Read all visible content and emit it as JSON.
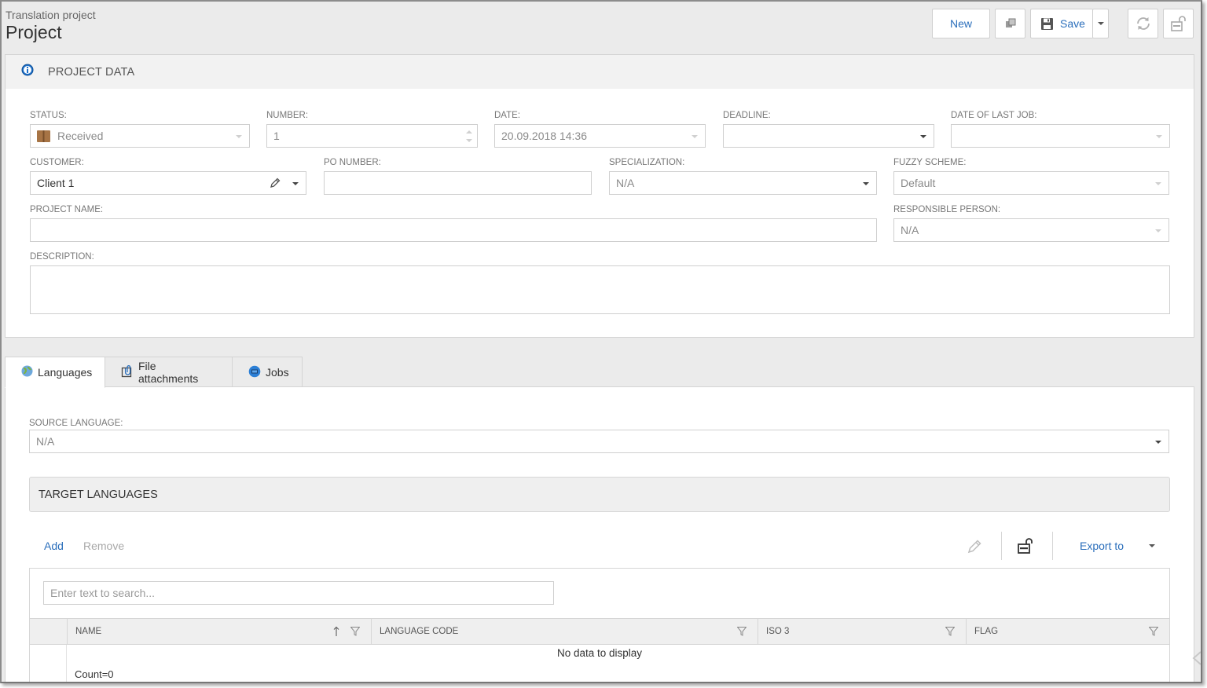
{
  "header": {
    "subtitle": "Translation project",
    "title": "Project",
    "new_label": "New",
    "save_label": "Save"
  },
  "project_data": {
    "title": "PROJECT DATA",
    "status_label": "STATUS:",
    "status_value": "Received",
    "number_label": "NUMBER:",
    "number_value": "1",
    "date_label": "DATE:",
    "date_value": "20.09.2018 14:36",
    "deadline_label": "DEADLINE:",
    "deadline_value": "",
    "date_last_job_label": "DATE OF LAST JOB:",
    "date_last_job_value": "",
    "customer_label": "CUSTOMER:",
    "customer_value": "Client 1",
    "po_number_label": "PO NUMBER:",
    "po_number_value": "",
    "specialization_label": "SPECIALIZATION:",
    "specialization_value": "N/A",
    "fuzzy_scheme_label": "FUZZY SCHEME:",
    "fuzzy_scheme_value": "Default",
    "project_name_label": "PROJECT NAME:",
    "project_name_value": "",
    "responsible_person_label": "RESPONSIBLE PERSON:",
    "responsible_person_value": "N/A",
    "description_label": "DESCRIPTION:",
    "description_value": ""
  },
  "tabs": [
    {
      "label": "Languages",
      "icon": "globe-icon",
      "active": true
    },
    {
      "label": "File attachments",
      "icon": "attachment-icon",
      "active": false
    },
    {
      "label": "Jobs",
      "icon": "jobs-icon",
      "active": false
    }
  ],
  "languages": {
    "source_language_label": "SOURCE LANGUAGE:",
    "source_language_value": "N/A",
    "target_languages_title": "TARGET LANGUAGES",
    "add_label": "Add",
    "remove_label": "Remove",
    "export_label": "Export to",
    "search_placeholder": "Enter text to search...",
    "columns": [
      "NAME",
      "LANGUAGE CODE",
      "ISO 3",
      "FLAG"
    ],
    "empty_text": "No data to display",
    "count_text": "Count=0"
  },
  "colors": {
    "accent": "#2a6ebb",
    "frame_bg": "#ebebeb",
    "panel_header_bg": "#f2f2f2"
  }
}
